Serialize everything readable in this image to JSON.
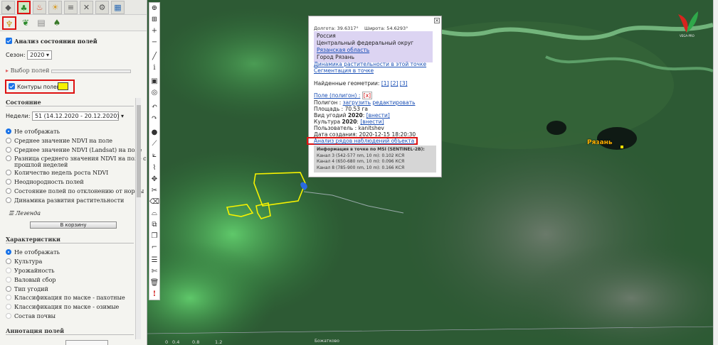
{
  "panel": {
    "section1": "Анализ состояния полей",
    "season_label": "Сезон:",
    "season_value": "2020",
    "field_choice": "Выбор полей",
    "contours": "Контуры полей",
    "state_hdr": "Состояние",
    "week_label": "Недели:",
    "week_value": "51 (14.12.2020 - 20.12.2020)",
    "state_opts": [
      "Не отображать",
      "Среднее значение NDVI на поле",
      "Среднее значение NDVI (Landsat) на поле",
      "Разница среднего значения NDVI на поле с",
      "прошлой неделей",
      "Количество недель роста NDVI",
      "Неоднородность полей",
      "Состояние полей по отклонению от нормы",
      "Динамика развития растительности"
    ],
    "legend": "Легенда",
    "basket": "В корзину",
    "char_hdr": "Характеристики",
    "char_opts": [
      "Не отображать",
      "Культура",
      "Урожайность",
      "Валовый сбор",
      "Тип угодий",
      "Классификация по маске - пахотные",
      "Классификация по маске - озимые",
      "Состав почвы"
    ],
    "annot_hdr": "Аннотация полей"
  },
  "popup": {
    "lon": "Долгота: 39.6317°",
    "lat": "Широта: 54.6293°",
    "addr": [
      "Россия",
      "Центральный федеральный округ",
      "Рязанская область",
      "Город Рязань"
    ],
    "link1": "Динамика растительности в этой точке",
    "link2": "Сегментация в точке",
    "found": "Найденные геометрии:",
    "g1": "[1]",
    "g2": "[2]",
    "g3": "[3]",
    "field": "Поле (полигон) :",
    "x": "[x]",
    "poly_label": "Полигон :",
    "load": "загрузить",
    "edit": "редактировать",
    "area": "Площадь : 70.53 га",
    "type_label": "Вид угодий",
    "year": "2020",
    "enter": "[внести]",
    "crop_label": "Культура",
    "user": "Пользователь : kanitshev",
    "created": "Дата создания: 2020-12-15 18:20:30",
    "analysis": "Анализ рядов наблюдений объекта",
    "info_title": "Информация в точке по MSI (SENTINEL-2B):",
    "ch": [
      "Канал 3 (542-577 nm, 10 m):   0.102 КСЯ",
      "Канал 4 (650-680 nm, 10 m):   0.096 КСЯ",
      "Канал 8 (785-900 nm, 10 m):   0.166 КСЯ"
    ]
  },
  "map": {
    "city": "Рязань",
    "brand": "VEGA-PRO",
    "scale": [
      "0",
      "0.4",
      "0.8",
      "1.2"
    ],
    "bottom": "Божатково"
  }
}
